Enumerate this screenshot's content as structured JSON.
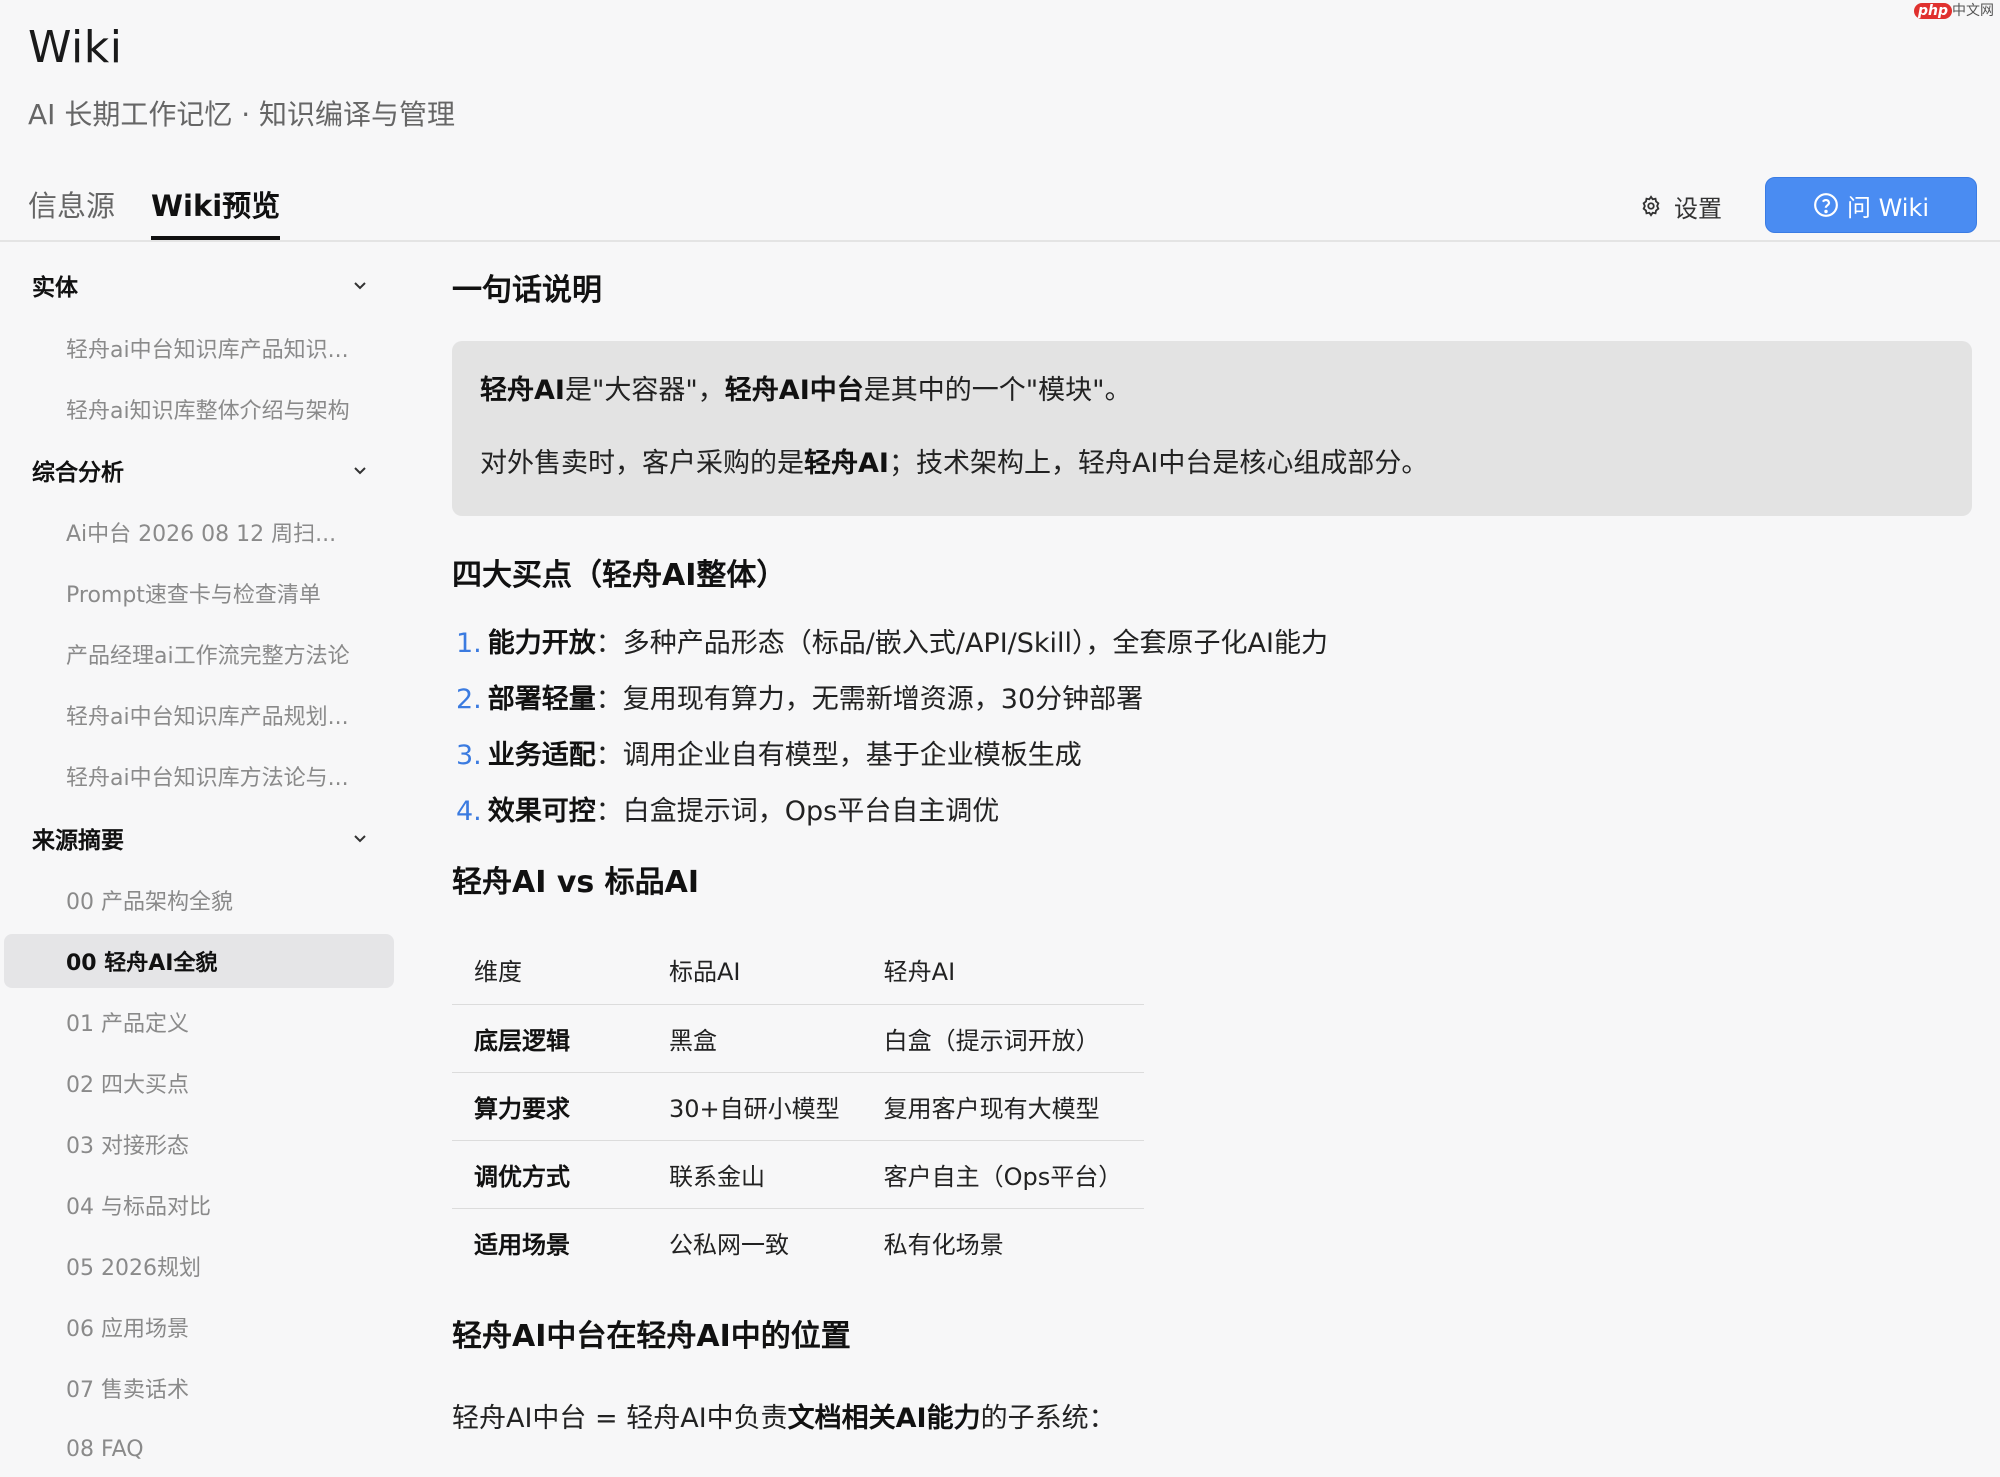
{
  "app": {
    "title": "Wiki",
    "subtitle": "AI 长期工作记忆 · 知识编译与管理"
  },
  "watermark": {
    "badge": "php",
    "text": "中文网"
  },
  "tabs": [
    {
      "label": "信息源",
      "active": false
    },
    {
      "label": "Wiki预览",
      "active": true
    }
  ],
  "toolbar": {
    "settings_label": "设置",
    "ask_label": "问 Wiki",
    "ask_color": "#4a8cf2"
  },
  "sidebar": {
    "sections": [
      {
        "title": "实体",
        "icon": "chevron-down-icon",
        "items": [
          "轻舟ai中台知识库产品知识...",
          "轻舟ai知识库整体介绍与架构"
        ]
      },
      {
        "title": "综合分析",
        "icon": "chevron-down-icon",
        "items": [
          "Ai中台 2026 08 12 周扫...",
          "Prompt速查卡与检查清单",
          "产品经理ai工作流完整方法论",
          "轻舟ai中台知识库产品规划...",
          "轻舟ai中台知识库方法论与..."
        ]
      },
      {
        "title": "来源摘要",
        "icon": "chevron-down-icon",
        "items": [
          "00 产品架构全貌",
          "00 轻舟AI全貌",
          "01 产品定义",
          "02 四大买点",
          "03 对接形态",
          "04 与标品对比",
          "05 2026规划",
          "06 应用场景",
          "07 售卖话术",
          "08 FAQ"
        ]
      }
    ],
    "active_item": "00 轻舟AI全貌"
  },
  "content": {
    "h_summary": "一句话说明",
    "callout": {
      "line1": {
        "a": "轻舟AI",
        "b": "是\"大容器\"，",
        "c": "轻舟AI中台",
        "d": "是其中的一个\"模块\"。"
      },
      "line2": {
        "a": "对外售卖时，客户采购的是",
        "b": "轻舟AI",
        "c": "；技术架构上，轻舟AI中台是核心组成部分。"
      }
    },
    "h_points": "四大买点（轻舟AI整体）",
    "points": [
      {
        "num": "1.",
        "title": "能力开放",
        "text": "：多种产品形态（标品/嵌入式/API/Skill），全套原子化AI能力"
      },
      {
        "num": "2.",
        "title": "部署轻量",
        "text": "：复用现有算力，无需新增资源，30分钟部署"
      },
      {
        "num": "3.",
        "title": "业务适配",
        "text": "：调用企业自有模型，基于企业模板生成"
      },
      {
        "num": "4.",
        "title": "效果可控",
        "text": "：白盒提示词，Ops平台自主调优"
      }
    ],
    "h_compare": "轻舟AI vs 标品AI",
    "table": {
      "headers": [
        "维度",
        "标品AI",
        "轻舟AI"
      ],
      "rows": [
        [
          "底层逻辑",
          "黑盒",
          "白盒（提示词开放）"
        ],
        [
          "算力要求",
          "30+自研小模型",
          "复用客户现有大模型"
        ],
        [
          "调优方式",
          "联系金山",
          "客户自主（Ops平台）"
        ],
        [
          "适用场景",
          "公私网一致",
          "私有化场景"
        ]
      ]
    },
    "h_position": "轻舟AI中台在轻舟AI中的位置",
    "position_text": {
      "a": "轻舟AI中台 = 轻舟AI中负责",
      "b": "文档相关AI能力",
      "c": "的子系统："
    }
  }
}
